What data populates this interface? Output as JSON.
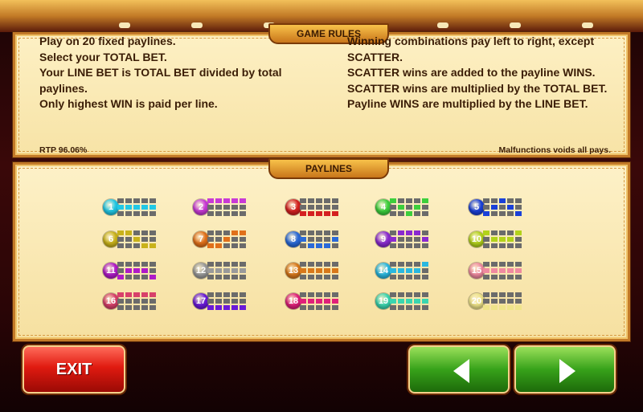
{
  "rules": {
    "banner": "GAME RULES",
    "left": [
      "Play on 20 fixed paylines.",
      "Select your TOTAL BET.",
      "Your LINE BET is TOTAL BET divided by total",
      "paylines.",
      "Only highest WIN is paid per line."
    ],
    "right": [
      "Winning combinations pay left to right, except",
      "SCATTER.",
      "SCATTER wins are added to the payline WINS.",
      "SCATTER wins are multiplied by the TOTAL BET.",
      "Payline WINS are multiplied by the LINE BET."
    ],
    "rtp": "RTP 96.06%",
    "malfunction": "Malfunctions voids all pays."
  },
  "paylines_banner": "PAYLINES",
  "paylines": [
    {
      "num": "1",
      "color": "#22c8e6",
      "rows": [
        [
          0,
          0,
          0,
          0,
          0
        ],
        [
          1,
          1,
          1,
          1,
          1
        ],
        [
          0,
          0,
          0,
          0,
          0
        ]
      ]
    },
    {
      "num": "2",
      "color": "#c83ad6",
      "rows": [
        [
          1,
          1,
          1,
          1,
          1
        ],
        [
          0,
          0,
          0,
          0,
          0
        ],
        [
          0,
          0,
          0,
          0,
          0
        ]
      ]
    },
    {
      "num": "3",
      "color": "#d42020",
      "rows": [
        [
          0,
          0,
          0,
          0,
          0
        ],
        [
          0,
          0,
          0,
          0,
          0
        ],
        [
          1,
          1,
          1,
          1,
          1
        ]
      ]
    },
    {
      "num": "4",
      "color": "#3ccf3c",
      "rows": [
        [
          1,
          0,
          0,
          0,
          1
        ],
        [
          0,
          1,
          0,
          1,
          0
        ],
        [
          0,
          0,
          1,
          0,
          0
        ]
      ]
    },
    {
      "num": "5",
      "color": "#1a40d8",
      "rows": [
        [
          0,
          0,
          1,
          0,
          0
        ],
        [
          0,
          1,
          0,
          1,
          0
        ],
        [
          1,
          0,
          0,
          0,
          1
        ]
      ]
    },
    {
      "num": "6",
      "color": "#c9b21a",
      "rows": [
        [
          1,
          1,
          0,
          0,
          0
        ],
        [
          0,
          0,
          1,
          0,
          0
        ],
        [
          0,
          0,
          0,
          1,
          1
        ]
      ]
    },
    {
      "num": "7",
      "color": "#e0701a",
      "rows": [
        [
          0,
          0,
          0,
          1,
          1
        ],
        [
          0,
          0,
          1,
          0,
          0
        ],
        [
          1,
          1,
          0,
          0,
          0
        ]
      ]
    },
    {
      "num": "8",
      "color": "#2a6ad8",
      "rows": [
        [
          0,
          0,
          0,
          0,
          0
        ],
        [
          1,
          0,
          0,
          0,
          1
        ],
        [
          0,
          1,
          1,
          1,
          0
        ]
      ]
    },
    {
      "num": "9",
      "color": "#8a2ad0",
      "rows": [
        [
          0,
          1,
          1,
          1,
          0
        ],
        [
          1,
          0,
          0,
          0,
          1
        ],
        [
          0,
          0,
          0,
          0,
          0
        ]
      ]
    },
    {
      "num": "10",
      "color": "#b2d21a",
      "rows": [
        [
          1,
          0,
          0,
          0,
          1
        ],
        [
          0,
          1,
          1,
          1,
          0
        ],
        [
          0,
          0,
          0,
          0,
          0
        ]
      ]
    },
    {
      "num": "11",
      "color": "#b01ac8",
      "rows": [
        [
          0,
          0,
          0,
          0,
          0
        ],
        [
          0,
          1,
          1,
          1,
          0
        ],
        [
          1,
          0,
          0,
          0,
          1
        ]
      ]
    },
    {
      "num": "12",
      "color": "#9a9a9a",
      "rows": [
        [
          0,
          0,
          0,
          0,
          0
        ],
        [
          1,
          1,
          1,
          1,
          1
        ],
        [
          0,
          0,
          0,
          0,
          0
        ]
      ]
    },
    {
      "num": "13",
      "color": "#d8781a",
      "rows": [
        [
          0,
          0,
          0,
          0,
          0
        ],
        [
          1,
          1,
          1,
          1,
          1
        ],
        [
          0,
          0,
          0,
          0,
          0
        ]
      ]
    },
    {
      "num": "14",
      "color": "#2ab8e0",
      "rows": [
        [
          0,
          0,
          0,
          0,
          1
        ],
        [
          1,
          1,
          1,
          1,
          0
        ],
        [
          0,
          0,
          0,
          0,
          0
        ]
      ]
    },
    {
      "num": "15",
      "color": "#f08aa0",
      "rows": [
        [
          0,
          0,
          0,
          0,
          0
        ],
        [
          1,
          1,
          1,
          1,
          1
        ],
        [
          0,
          0,
          0,
          0,
          0
        ]
      ]
    },
    {
      "num": "16",
      "color": "#d8406a",
      "rows": [
        [
          1,
          1,
          1,
          1,
          1
        ],
        [
          0,
          0,
          0,
          0,
          0
        ],
        [
          0,
          0,
          0,
          0,
          0
        ]
      ]
    },
    {
      "num": "17",
      "color": "#6a1ad8",
      "rows": [
        [
          0,
          0,
          0,
          0,
          0
        ],
        [
          0,
          0,
          0,
          0,
          0
        ],
        [
          1,
          1,
          1,
          1,
          1
        ]
      ]
    },
    {
      "num": "18",
      "color": "#e0207a",
      "rows": [
        [
          0,
          0,
          0,
          0,
          0
        ],
        [
          1,
          1,
          1,
          1,
          1
        ],
        [
          0,
          0,
          0,
          0,
          0
        ]
      ]
    },
    {
      "num": "19",
      "color": "#3ad6b0",
      "rows": [
        [
          0,
          0,
          0,
          0,
          0
        ],
        [
          1,
          1,
          1,
          1,
          1
        ],
        [
          0,
          0,
          0,
          0,
          0
        ]
      ]
    },
    {
      "num": "20",
      "color": "#efe48a",
      "rows": [
        [
          0,
          0,
          0,
          0,
          0
        ],
        [
          0,
          0,
          0,
          0,
          0
        ],
        [
          1,
          1,
          1,
          1,
          1
        ]
      ]
    }
  ],
  "buttons": {
    "exit": "EXIT",
    "prev_icon": "arrow-left-icon",
    "next_icon": "arrow-right-icon"
  }
}
